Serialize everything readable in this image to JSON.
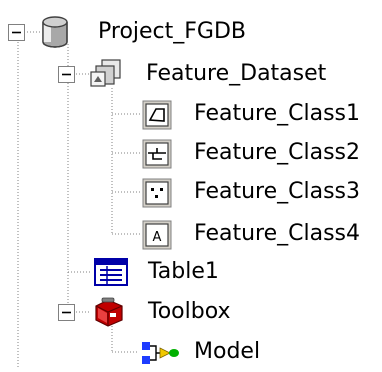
{
  "tree": {
    "root": {
      "label": "Project_FGDB",
      "icon": "geodatabase-cylinder-icon",
      "expanded": true
    },
    "dataset": {
      "label": "Feature_Dataset",
      "icon": "feature-dataset-icon",
      "expanded": true
    },
    "feature_classes": [
      {
        "label": "Feature_Class1",
        "icon": "polygon-feature-class-icon"
      },
      {
        "label": "Feature_Class2",
        "icon": "line-feature-class-icon"
      },
      {
        "label": "Feature_Class3",
        "icon": "point-feature-class-icon"
      },
      {
        "label": "Feature_Class4",
        "icon": "annotation-feature-class-icon",
        "glyph": "A"
      }
    ],
    "table": {
      "label": "Table1",
      "icon": "table-icon"
    },
    "toolbox": {
      "label": "Toolbox",
      "icon": "toolbox-icon",
      "expanded": true
    },
    "model": {
      "label": "Model",
      "icon": "model-icon"
    },
    "expander_glyph": "−"
  },
  "colors": {
    "dotted_line": "#808080",
    "table_blue": "#0000a8",
    "toolbox_red": "#c00000",
    "model_blue": "#1e3cff",
    "model_yellow": "#f0c800",
    "model_green": "#00b000"
  }
}
